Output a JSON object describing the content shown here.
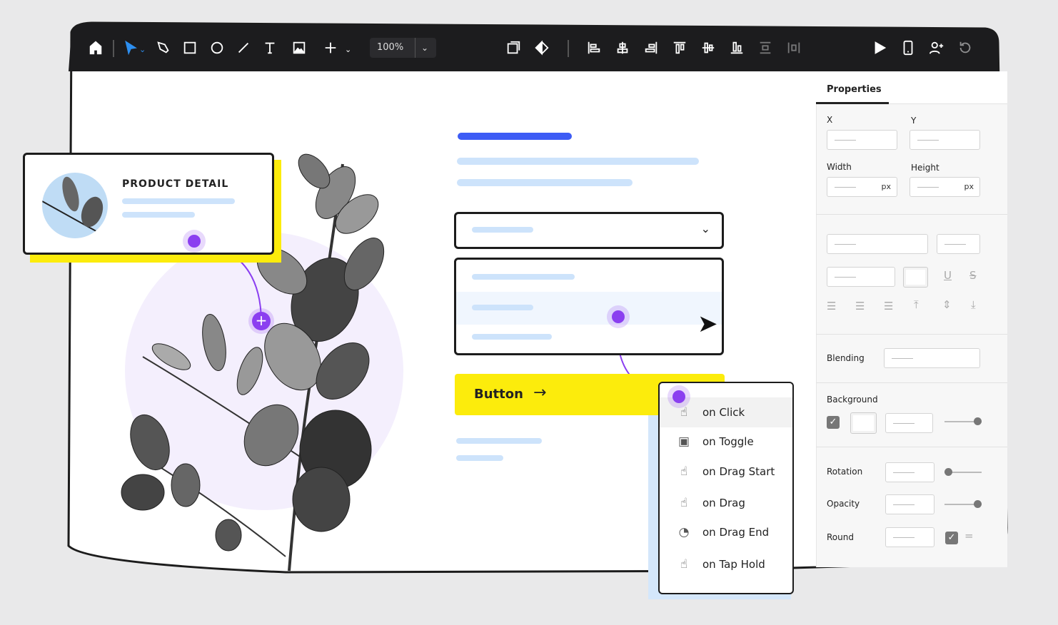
{
  "toolbar": {
    "zoom": "100%",
    "icons": [
      "home-icon",
      "select-arrow-icon",
      "pen-icon",
      "rectangle-icon",
      "ellipse-icon",
      "line-icon",
      "text-icon",
      "image-icon",
      "plus-icon",
      "component-icon",
      "mask-icon",
      "align-left-icon",
      "align-center-icon",
      "align-right-icon",
      "align-top-icon",
      "align-middle-icon",
      "align-bottom-icon",
      "distribute-vertical-icon",
      "distribute-horizontal-icon",
      "play-icon",
      "device-preview-icon",
      "add-user-icon",
      "undo-icon"
    ]
  },
  "card": {
    "title": "PRODUCT DETAIL"
  },
  "button": {
    "label": "Button"
  },
  "menu": {
    "items": [
      {
        "label": "on Click",
        "icon": "hand-pointer-icon"
      },
      {
        "label": "on Toggle",
        "icon": "toggle-icon"
      },
      {
        "label": "on Drag Start",
        "icon": "drag-start-icon"
      },
      {
        "label": "on Drag",
        "icon": "drag-icon"
      },
      {
        "label": "on Drag End",
        "icon": "drag-end-icon"
      },
      {
        "label": "on Tap Hold",
        "icon": "tap-hold-icon"
      }
    ]
  },
  "properties": {
    "tab": "Properties",
    "x": "X",
    "y": "Y",
    "width": "Width",
    "height": "Height",
    "unit": "px",
    "blending": "Blending",
    "background": "Background",
    "rotation": "Rotation",
    "opacity": "Opacity",
    "round": "Round",
    "background_slider": 1.0,
    "rotation_slider": 0.0,
    "opacity_slider": 1.0
  },
  "colors": {
    "accent": "#8b3ff0",
    "yellow": "#fcec0c",
    "blue": "#3d5cf5",
    "lightblue": "#cde3fb"
  }
}
